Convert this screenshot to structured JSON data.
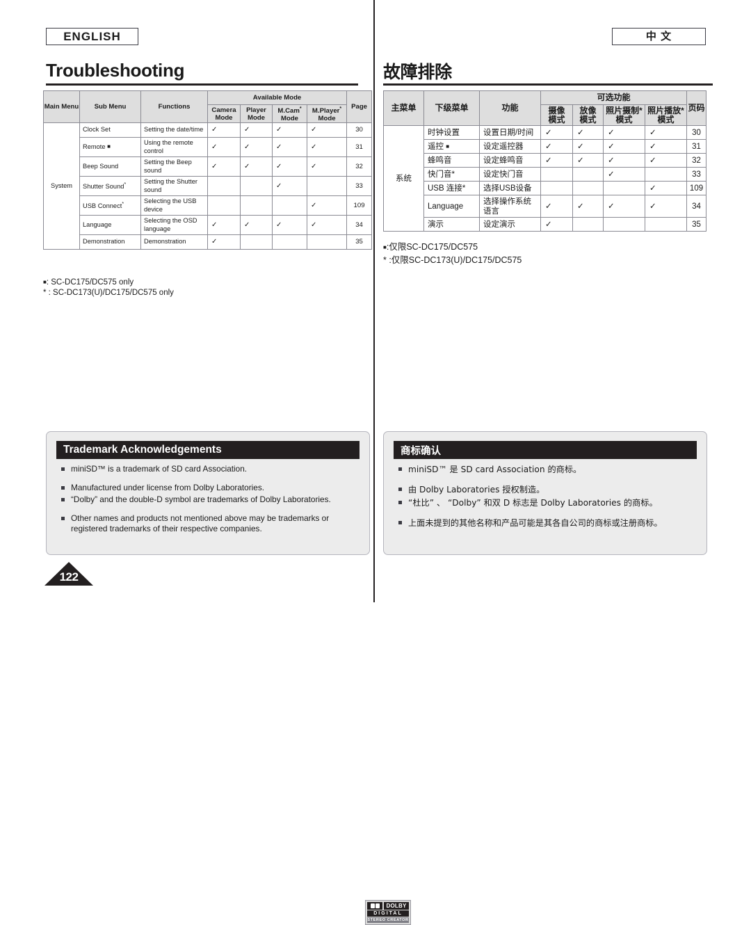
{
  "english": {
    "lang_tag": "ENGLISH",
    "page_title": "Troubleshooting",
    "table": {
      "header": {
        "main_menu": "Main Menu",
        "sub_menu": "Sub Menu",
        "functions": "Functions",
        "available_mode": "Available Mode",
        "modes": [
          "Camera Mode",
          "Player Mode",
          "M.Cam",
          "M.Player"
        ],
        "mode_marks": [
          "",
          "",
          "*",
          "*"
        ],
        "page": "Page"
      },
      "main_menu_value": "System",
      "rows": [
        {
          "sub_menu": "Clock Set",
          "mark": "",
          "functions": "Setting the date/time",
          "modes": [
            true,
            true,
            true,
            true
          ],
          "page": "30"
        },
        {
          "sub_menu": "Remote",
          "mark": "square",
          "functions": "Using the remote control",
          "modes": [
            true,
            true,
            true,
            true
          ],
          "page": "31"
        },
        {
          "sub_menu": "Beep Sound",
          "mark": "",
          "functions": "Setting the Beep sound",
          "modes": [
            true,
            true,
            true,
            true
          ],
          "page": "32"
        },
        {
          "sub_menu": "Shutter Sound",
          "mark": "star",
          "functions": "Setting the Shutter sound",
          "modes": [
            false,
            false,
            true,
            false
          ],
          "page": "33"
        },
        {
          "sub_menu": "USB Connect",
          "mark": "star",
          "functions": "Selecting the USB device",
          "modes": [
            false,
            false,
            false,
            true
          ],
          "page": "109"
        },
        {
          "sub_menu": "Language",
          "mark": "",
          "functions": "Selecting the OSD language",
          "modes": [
            true,
            true,
            true,
            true
          ],
          "page": "34"
        },
        {
          "sub_menu": "Demonstration",
          "mark": "",
          "functions": "Demonstration",
          "modes": [
            true,
            false,
            false,
            false
          ],
          "page": "35"
        }
      ]
    },
    "footnotes": [
      ": SC-DC175/DC575 only",
      "* : SC-DC173(U)/DC175/DC575 only"
    ],
    "trademark": {
      "heading": "Trademark Acknowledgements",
      "items": [
        "miniSD™ is a trademark of SD card Association.",
        "Manufactured under license from Dolby Laboratories.",
        "“Dolby” and the double-D symbol are trademarks of Dolby Laboratories.",
        "Other names and products not mentioned above may be trademarks or registered trademarks of their respective companies."
      ]
    }
  },
  "chinese": {
    "lang_tag": "中  文",
    "page_title": "故障排除",
    "table": {
      "header": {
        "main_menu": "主菜单",
        "sub_menu": "下级菜单",
        "functions": "功能",
        "available_mode": "可选功能",
        "modes": [
          "摄像 模式",
          "放像 模式",
          "照片摄制* 模式",
          "照片播放* 模式"
        ],
        "page": "页码"
      },
      "main_menu_value": "系统",
      "rows": [
        {
          "sub_menu": "时钟设置",
          "mark": "",
          "functions": "设置日期/时间",
          "modes": [
            true,
            true,
            true,
            true
          ],
          "page": "30"
        },
        {
          "sub_menu": "遥控",
          "mark": "square",
          "functions": "设定遥控器",
          "modes": [
            true,
            true,
            true,
            true
          ],
          "page": "31"
        },
        {
          "sub_menu": "蜂鸣音",
          "mark": "",
          "functions": "设定蜂鸣音",
          "modes": [
            true,
            true,
            true,
            true
          ],
          "page": "32"
        },
        {
          "sub_menu": "快门音*",
          "mark": "",
          "functions": "设定快门音",
          "modes": [
            false,
            false,
            true,
            false
          ],
          "page": "33"
        },
        {
          "sub_menu": "USB 连接*",
          "mark": "",
          "functions": "选择USB设备",
          "modes": [
            false,
            false,
            false,
            true
          ],
          "page": "109"
        },
        {
          "sub_menu": "Language",
          "mark": "",
          "functions": "选择操作系统 语言",
          "modes": [
            true,
            true,
            true,
            true
          ],
          "page": "34"
        },
        {
          "sub_menu": "演示",
          "mark": "",
          "functions": "设定演示",
          "modes": [
            true,
            false,
            false,
            false
          ],
          "page": "35"
        }
      ]
    },
    "footnotes": [
      ":仅限SC-DC175/DC575",
      "* :仅限SC-DC173(U)/DC175/DC575"
    ],
    "trademark": {
      "heading": "商标确认",
      "items": [
        "miniSD™ 是 SD card Association 的商标。",
        "由 Dolby Laboratories 授权制造。",
        "“杜比” 、 “Dolby” 和双 D 标志是 Dolby Laboratories 的商标。",
        "上面未提到的其他名称和产品可能是其各自公司的商标或注册商标。"
      ]
    }
  },
  "dolby_logo": {
    "word": "DOLBY",
    "line2": "DIGITAL",
    "line3": "STEREO CREATOR"
  },
  "page_number": "122",
  "checkmark": "✓",
  "colors": {
    "header_fill": "#dedede",
    "rule": "#231f20",
    "panel_fill": "#ececec"
  }
}
